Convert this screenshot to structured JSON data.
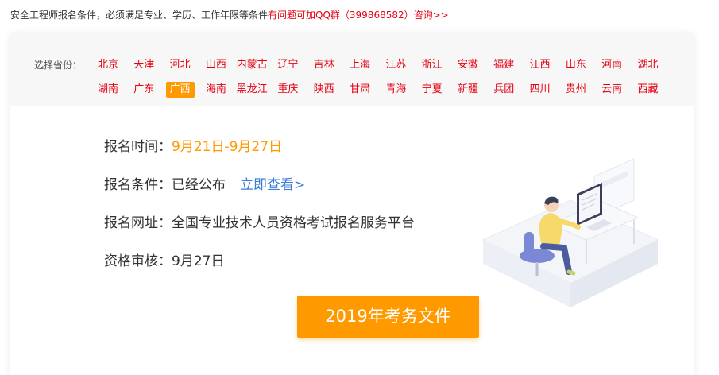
{
  "notice": {
    "text": "安全工程师报名条件，必须满足专业、学历、工作年限等条件",
    "qq_text": "有问题可加QQ群（399868582）咨询>>"
  },
  "province_selector": {
    "label": "选择省份：",
    "active": "广西",
    "rows": [
      [
        "北京",
        "天津",
        "河北",
        "山西",
        "内蒙古",
        "辽宁",
        "吉林",
        "上海",
        "江苏",
        "浙江",
        "安徽",
        "福建",
        "江西",
        "山东",
        "河南",
        "湖北"
      ],
      [
        "湖南",
        "广东",
        "广西",
        "海南",
        "黑龙江",
        "重庆",
        "陕西",
        "甘肃",
        "青海",
        "宁夏",
        "新疆",
        "兵团",
        "四川",
        "贵州",
        "云南",
        "西藏"
      ]
    ]
  },
  "info": {
    "reg_time_label": "报名时间：",
    "reg_time_value": "9月21日-9月27日",
    "reg_cond_label": "报名条件：",
    "reg_cond_value": "已经公布",
    "reg_cond_link": "立即查看>",
    "reg_site_label": "报名网址：",
    "reg_site_value": "全国专业技术人员资格考试报名服务平台",
    "review_label": "资格审核：",
    "review_value": "9月27日"
  },
  "doc_button": "2019年考务文件",
  "colors": {
    "accent": "#ff9900",
    "link_red": "#e60012",
    "link_blue": "#3b7dd8",
    "bar_bg": "#f7f7f7"
  },
  "icons": {
    "illustration": "person-at-computer-illustration"
  }
}
